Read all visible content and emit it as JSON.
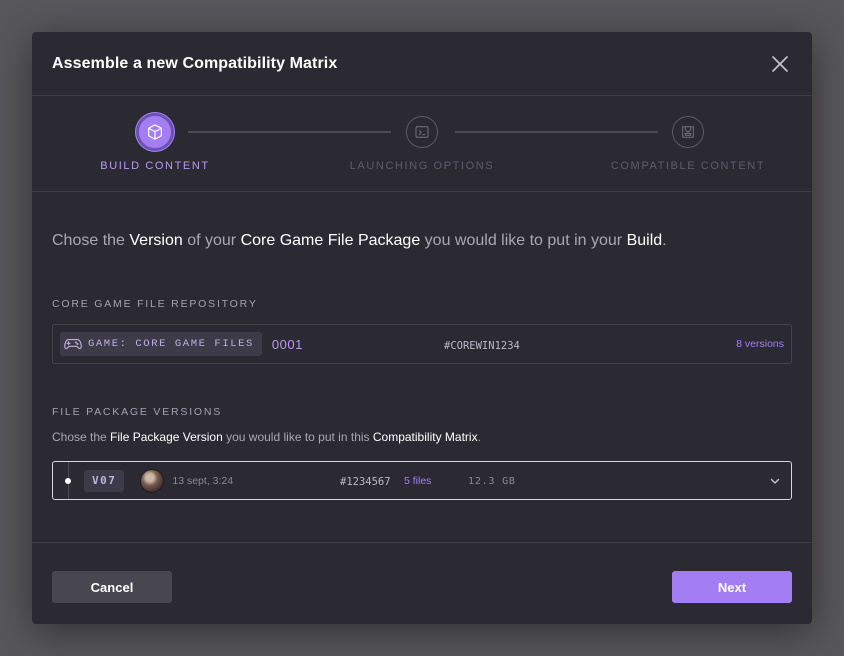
{
  "dialog": {
    "title": "Assemble a new Compatibility Matrix"
  },
  "stepper": {
    "steps": [
      {
        "label": "BUILD CONTENT",
        "icon": "cube-icon",
        "state": "active"
      },
      {
        "label": "LAUNCHING OPTIONS",
        "icon": "terminal-icon",
        "state": "inactive"
      },
      {
        "label": "COMPATIBLE CONTENT",
        "icon": "package-icon",
        "state": "inactive"
      }
    ]
  },
  "lead": {
    "part1": "Chose the ",
    "hl1": "Version",
    "part2": " of your ",
    "hl2": "Core Game File Package",
    "part3": " you would like to put in your ",
    "hl3": "Build",
    "part4": "."
  },
  "repository": {
    "section_label": "CORE GAME FILE REPOSITORY",
    "badge_icon": "gamepad-icon",
    "badge_label": "GAME: CORE GAME FILES",
    "id": "0001",
    "hash": "#COREWIN1234",
    "versions": "8 versions"
  },
  "file_package": {
    "section_label": "FILE PACKAGE VERSIONS",
    "desc_part1": "Chose the ",
    "desc_hl1": "File Package Version",
    "desc_part2": " you would like to put in this ",
    "desc_hl2": "Compatibility Matrix",
    "desc_part3": ".",
    "selected": {
      "version": "V07",
      "date": "13 sept, 3:24",
      "hash": "#1234567",
      "files": "5 files",
      "size": "12.3 GB"
    }
  },
  "footer": {
    "cancel_label": "Cancel",
    "next_label": "Next"
  },
  "colors": {
    "accent": "#a37ef2",
    "background": "#2b2a33",
    "overlay": "#58575c"
  }
}
